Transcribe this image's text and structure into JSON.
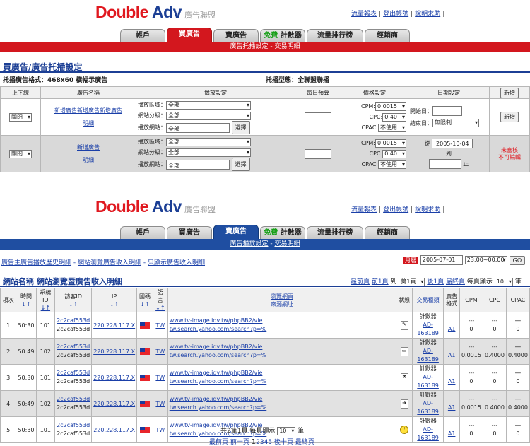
{
  "brand": {
    "word1": "Double",
    "word2": "Adv",
    "sub": "廣告聯盟"
  },
  "toplinks": [
    "流量報表",
    "登出帳號",
    "說明求助"
  ],
  "tabs": [
    {
      "label": "帳戶"
    },
    {
      "label": "買廣告"
    },
    {
      "label": "賣廣告"
    },
    {
      "label_free": "免費",
      "label": "計數器"
    },
    {
      "label": "流量排行榜"
    },
    {
      "label": "經銷商"
    }
  ],
  "section1": {
    "subnav": [
      "廣告托播設定",
      "交易明細"
    ],
    "title": "買廣告/廣告托播設定",
    "format_label": "托播廣告格式：468x60 橫幅示廣告",
    "type_label": "托播型態：全聯盟聯播",
    "headers": [
      "上下線",
      "廣告名稱",
      "播放設定",
      "每日預算",
      "價格設定",
      "日期設定"
    ],
    "new_button": "新增",
    "rows": [
      {
        "status": "關閉",
        "name": "新增廣告新增廣告新增廣告",
        "detail": "明細",
        "region_label": "播放區域：",
        "region": "全部",
        "cat_label": "網站分級：",
        "cat": "全部",
        "site_label": "播放網站：",
        "site": "全部",
        "select": "選擇",
        "cpm_label": "CPM:",
        "cpm": "0.0015",
        "cpc_label": "CPC:",
        "cpc": "0.40",
        "cpac_label": "CPAC:",
        "cpac": "不使用",
        "start_label": "開始日：",
        "end_label": "結束日：",
        "end": "無限制",
        "action": "新增"
      },
      {
        "status": "關閉",
        "name": "新增廣告",
        "detail": "明細",
        "region_label": "播放區域：",
        "region": "全部",
        "cat_label": "網站分級：",
        "cat": "全部",
        "site_label": "播放網站：",
        "site": "全部",
        "select": "選擇",
        "cpm_label": "CPM:",
        "cpm": "0.0015",
        "cpc_label": "CPC:",
        "cpc": "0.40",
        "cpac_label": "CPAC:",
        "cpac": "不使用",
        "from_label": "從",
        "from": "2005-10-04",
        "to_label": "到",
        "stop_label": "止",
        "action1": "未審核",
        "action2": "不可編輯"
      }
    ]
  },
  "section2": {
    "subnav": [
      "廣告播放設定",
      "交易明細"
    ],
    "filters": [
      "廣告主廣告播放歷史明細",
      "網站瀏覽廣告收入明細",
      "只顯示廣告收入明細"
    ],
    "month_label": "月曆",
    "date": "2005-07-01",
    "time": "23:00~00:00",
    "go": "GO",
    "title_a": "網站名稱",
    "title_b": "網站瀏覽暨廣告收入明細",
    "pager_top": {
      "first": "最前頁",
      "prev": "前1頁",
      "to": "到",
      "page": "第1頁",
      "next": "後1頁",
      "last": "最終頁",
      "per": "每頁顯示",
      "count": "10",
      "unit": "筆"
    },
    "headers": [
      "項次",
      "時間",
      "系統ID",
      "訪客ID",
      "IP",
      "國碼",
      "語言",
      "瀏覽網頁",
      "狀態",
      "交易種類",
      "廣告格式",
      "CPM",
      "CPC",
      "CPAC"
    ],
    "sub_headers": {
      "browse2": "來源網址",
      "sort": "↓↑"
    },
    "rows": [
      {
        "n": "1",
        "time": "50:30",
        "sys": "101",
        "vid1": "2c2caf553d",
        "vid2": "2c2caf553d",
        "ip": "220.228.117.X",
        "lang": "TW",
        "url1": "www.tv-image.idv.tw/phpBB2/vie",
        "url2": "tw.search.yahoo.com/search?p=%",
        "kind": "計數器",
        "ad": "AD-163189",
        "fmt": "A1",
        "cpm1": "---",
        "cpc1": "---",
        "cpac1": "---",
        "cpm2": "0",
        "cpc2": "0",
        "cpac2": "0",
        "icon": "edit"
      },
      {
        "n": "2",
        "time": "50:49",
        "sys": "102",
        "vid1": "2c2caf553d",
        "vid2": "2c2caf553d",
        "ip": "220.228.117.X",
        "lang": "TW",
        "url1": "www.tv-image.idv.tw/phpBB2/vie",
        "url2": "tw.search.yahoo.com/search?p=%",
        "kind": "計數器",
        "ad": "AD-163189",
        "fmt": "A1",
        "cpm1": "---",
        "cpc1": "---",
        "cpac1": "---",
        "cpm2": "0.0015",
        "cpc2": "0.4000",
        "cpac2": "0.4000",
        "icon": "doc"
      },
      {
        "n": "3",
        "time": "50:30",
        "sys": "101",
        "vid1": "2c2caf553d",
        "vid2": "2c2caf553d",
        "ip": "220.228.117.X",
        "lang": "TW",
        "url1": "www.tv-image.idv.tw/phpBB2/vie",
        "url2": "tw.search.yahoo.com/search?p=%",
        "kind": "計數器",
        "ad": "AD-163189",
        "fmt": "A1",
        "cpm1": "---",
        "cpc1": "---",
        "cpac1": "---",
        "cpm2": "0",
        "cpc2": "0",
        "cpac2": "0",
        "icon": "del"
      },
      {
        "n": "4",
        "time": "50:49",
        "sys": "102",
        "vid1": "2c2caf553d",
        "vid2": "2c2caf553d",
        "ip": "220.228.117.X",
        "lang": "TW",
        "url1": "www.tv-image.idv.tw/phpBB2/vie",
        "url2": "tw.search.yahoo.com/search?p=%",
        "kind": "計數器",
        "ad": "AD-163189",
        "fmt": "A1",
        "cpm1": "---",
        "cpc1": "---",
        "cpac1": "---",
        "cpm2": "0.0015",
        "cpc2": "0.4000",
        "cpac2": "0.4000",
        "icon": "nav"
      },
      {
        "n": "5",
        "time": "50:30",
        "sys": "101",
        "vid1": "2c2caf553d",
        "vid2": "2c2caf553d",
        "ip": "220.228.117.X",
        "lang": "TW",
        "url1": "www.tv-image.idv.tw/phpBB2/vie",
        "url2": "tw.search.yahoo.com/search?p=%",
        "kind": "計數器",
        "ad": "AD-163189",
        "fmt": "A1",
        "cpm1": "---",
        "cpc1": "---",
        "cpac1": "---",
        "cpm2": "0",
        "cpc2": "0",
        "cpac2": "0",
        "icon": "warn"
      }
    ],
    "footer": {
      "summary": "共2筆1頁",
      "per": "每頁顯示",
      "count": "10",
      "unit": "筆",
      "first": "最前頁",
      "prev": "前十頁",
      "pages": [
        "1",
        "2",
        "3",
        "4",
        "5"
      ],
      "next": "後十頁",
      "last": "最終頁"
    }
  },
  "colors": {
    "red": "#d3171e",
    "blue": "#1f4ea1",
    "link": "#1a3fa8"
  }
}
